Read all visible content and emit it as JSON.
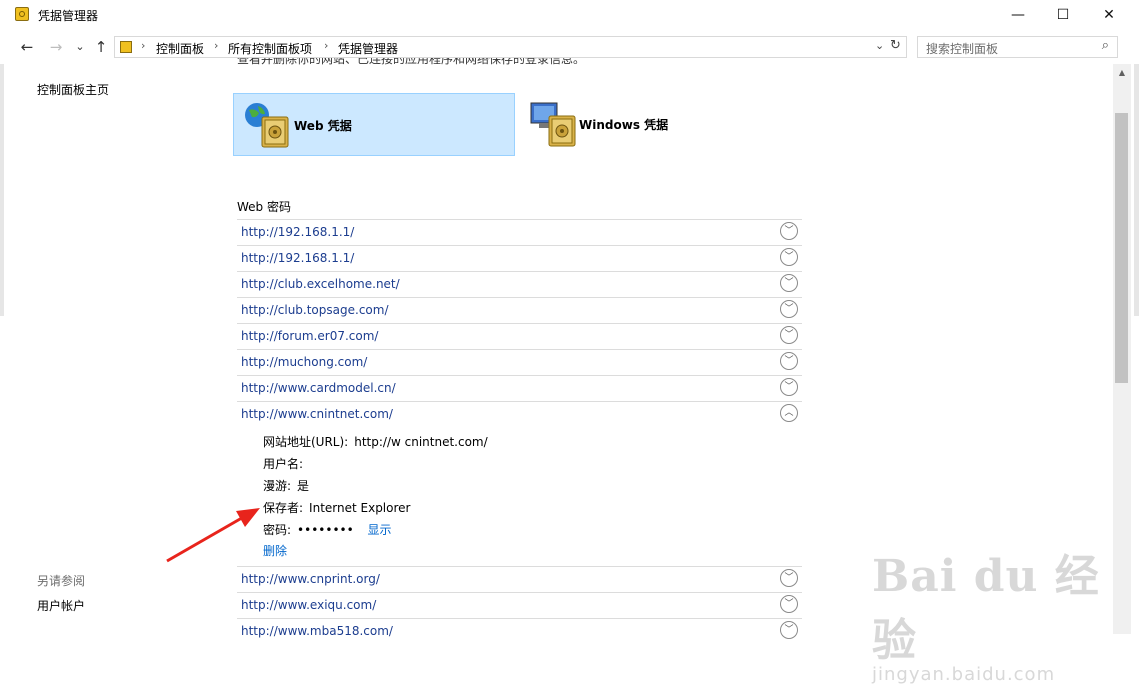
{
  "window": {
    "title": "凭据管理器",
    "minimize": "—",
    "maximize": "☐",
    "close": "✕"
  },
  "nav": {
    "back": "←",
    "forward": "→",
    "recent": "⌄",
    "up": "↑",
    "breadcrumbs": [
      "控制面板",
      "所有控制面板项",
      "凭据管理器"
    ],
    "separator": "›",
    "dropdown": "⌄",
    "refresh": "↻"
  },
  "search": {
    "placeholder": "搜索控制面板",
    "icon": "search-icon"
  },
  "sidebar": {
    "home_link": "控制面板主页",
    "see_also_title": "另请参阅",
    "see_also_links": [
      "用户帐户"
    ]
  },
  "main": {
    "intro_text": "查看并删除你的网站、已连接的应用程序和网络保存的登录信息。",
    "tiles": [
      {
        "label": "Web 凭据",
        "icon": "web-credential-icon",
        "selected": true
      },
      {
        "label": "Windows 凭据",
        "icon": "windows-credential-icon",
        "selected": false
      }
    ],
    "section_title": "Web 密码",
    "entries": [
      {
        "url": "http://192.168.1.1/",
        "expanded": false
      },
      {
        "url": "http://192.168.1.1/",
        "expanded": false
      },
      {
        "url": "http://club.excelhome.net/",
        "expanded": false
      },
      {
        "url": "http://club.topsage.com/",
        "expanded": false
      },
      {
        "url": "http://forum.er07.com/",
        "expanded": false
      },
      {
        "url": "http://muchong.com/",
        "expanded": false
      },
      {
        "url": "http://www.cardmodel.cn/",
        "expanded": false
      },
      {
        "url": "http://www.cnintnet.com/",
        "expanded": true
      },
      {
        "url": "http://www.cnprint.org/",
        "expanded": false
      },
      {
        "url": "http://www.exiqu.com/",
        "expanded": false
      },
      {
        "url": "http://www.mba518.com/",
        "expanded": false
      }
    ],
    "expanded_detail": {
      "site_label": "网站地址(URL):",
      "site_value": "http://w    cnintnet.com/",
      "user_label": "用户名:",
      "user_value": "",
      "roaming_label": "漫游:",
      "roaming_value": "是",
      "saved_by_label": "保存者:",
      "saved_by_value": "Internet Explorer",
      "password_label": "密码:",
      "password_value": "••••••••",
      "show_link": "显示",
      "delete_link": "删除"
    },
    "expand_glyph": "﹀",
    "collapse_glyph": "︿"
  },
  "watermark": {
    "logo": "Bai du 经验",
    "sub": "jingyan.baidu.com"
  },
  "colors": {
    "link": "#1c3d8f",
    "action": "#0066cc",
    "selected_tile": "#cce8ff",
    "annotation": "#e8241c"
  }
}
